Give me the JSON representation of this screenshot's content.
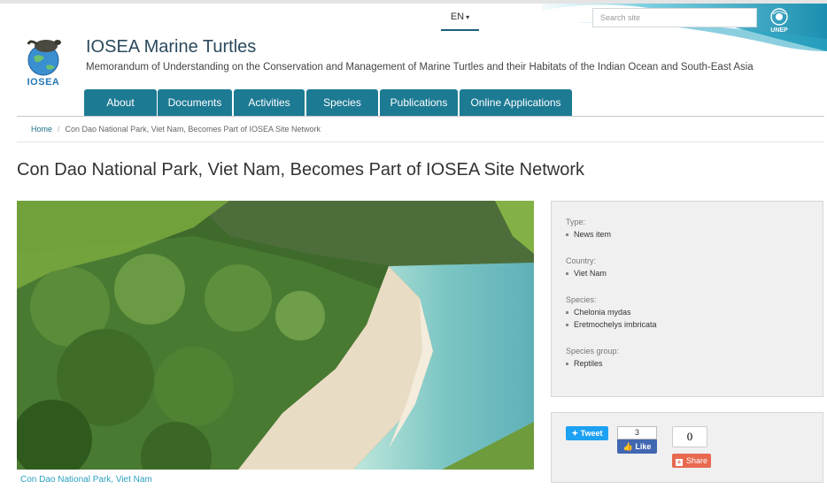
{
  "language": {
    "label": "EN"
  },
  "search": {
    "placeholder": "Search site"
  },
  "unep_logo": {
    "text": "UNEP"
  },
  "site": {
    "logo_text": "IOSEA",
    "title": "IOSEA Marine Turtles",
    "subtitle": "Memorandum of Understanding on the Conservation and Management of Marine Turtles and their Habitats of the Indian Ocean and South-East Asia"
  },
  "nav": [
    {
      "label": "About"
    },
    {
      "label": "Documents"
    },
    {
      "label": "Activities"
    },
    {
      "label": "Species"
    },
    {
      "label": "Publications"
    },
    {
      "label": "Online Applications"
    }
  ],
  "breadcrumb": {
    "home": "Home",
    "current": "Con Dao National Park, Viet Nam, Becomes Part of IOSEA Site Network"
  },
  "page": {
    "title": "Con Dao National Park, Viet Nam, Becomes Part of IOSEA Site Network"
  },
  "image": {
    "caption": "Con Dao National Park, Viet Nam"
  },
  "info": {
    "type_label": "Type:",
    "type_value": "News item",
    "country_label": "Country:",
    "country_value": "Viet Nam",
    "species_label": "Species:",
    "species_values": [
      "Chelonia mydas",
      "Eretmochelys imbricata"
    ],
    "group_label": "Species group:",
    "group_value": "Reptiles"
  },
  "social": {
    "tweet_label": "Tweet",
    "like_count": "3",
    "like_label": "Like",
    "share_count": "0",
    "share_label": "Share"
  },
  "colors": {
    "nav": "#1d7a93",
    "banner": "#2ba7c4",
    "link": "#2aa0c0"
  }
}
